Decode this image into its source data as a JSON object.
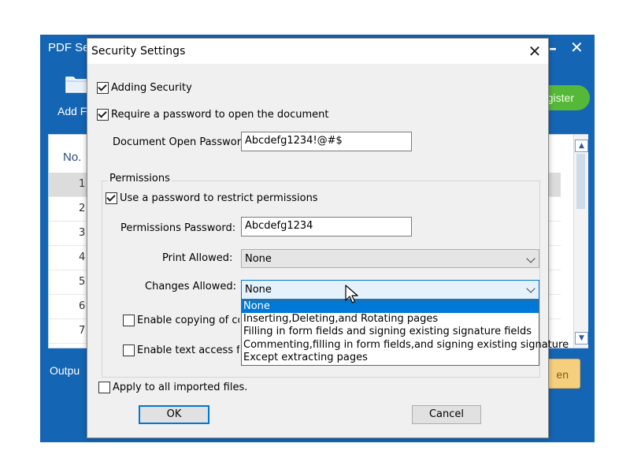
{
  "app": {
    "title": "PDF Se",
    "add_label": "Add F",
    "register_label": "gister",
    "list_header_no": "No.",
    "rows": [
      "1",
      "2",
      "3",
      "4",
      "5",
      "6",
      "7"
    ],
    "output_label": "Outpu",
    "open_label": "en"
  },
  "dialog": {
    "title": "Security Settings",
    "adding_security": {
      "label": "Adding Security",
      "checked": true
    },
    "require_password": {
      "label": "Require a password to open the document",
      "checked": true
    },
    "open_password": {
      "label": "Document Open Password:",
      "value": "Abcdefg1234!@#$"
    },
    "permissions": {
      "group_label": "Permissions",
      "use_password": {
        "label": "Use a password to restrict permissions",
        "checked": true
      },
      "password": {
        "label": "Permissions Password:",
        "value": "Abcdefg1234"
      },
      "print_allowed": {
        "label": "Print Allowed:",
        "value": "None"
      },
      "changes_allowed": {
        "label": "Changes Allowed:",
        "value": "None",
        "options": [
          "None",
          "Inserting,Deleting,and Rotating pages",
          "Filling in form fields and signing existing signature fields",
          "Commenting,filling in form fields,and signing existing signature",
          "Except extracting pages"
        ],
        "selected_index": 0
      },
      "enable_copying": {
        "label": "Enable copying of con",
        "checked": false
      },
      "enable_text_access": {
        "label": "Enable text access fo",
        "checked": false
      }
    },
    "apply_all": {
      "label": "Apply to all imported files.",
      "checked": false
    },
    "ok_label": "OK",
    "cancel_label": "Cancel"
  },
  "colors": {
    "app_blue": "#1565b5",
    "accent": "#0078d7",
    "register_green": "#56b838",
    "open_orange": "#f6cf7e"
  }
}
